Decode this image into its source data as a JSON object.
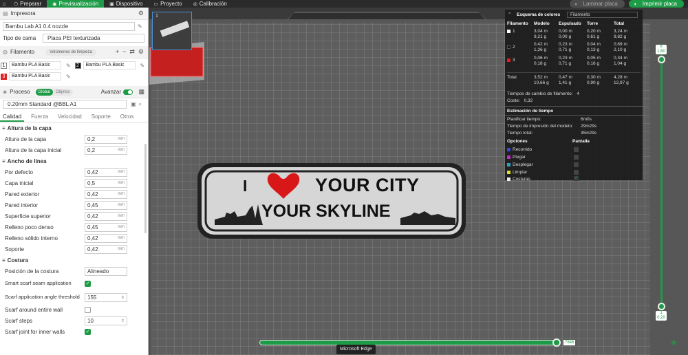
{
  "topbar": {
    "home_icon": "home-icon",
    "tabs": [
      {
        "label": "Preparar",
        "icon": "cube-icon"
      },
      {
        "label": "Previsualización",
        "icon": "eye-icon"
      },
      {
        "label": "Dispositivo",
        "icon": "printer-icon"
      },
      {
        "label": "Proyecto",
        "icon": "folder-icon"
      },
      {
        "label": "Calibración",
        "icon": "gauge-icon"
      }
    ],
    "laminar": "Laminar placa",
    "imprimir": "Imprimir placa"
  },
  "printer": {
    "section": "Impresora",
    "name": "Bambu Lab A1 0.4 nozzle",
    "bed_label": "Tipo de cama",
    "bed_value": "Placa PEI texturizada"
  },
  "filament": {
    "section": "Filamento",
    "pill": "Volúmenes de limpieza",
    "items": [
      {
        "num": "1",
        "name": "Bambu PLA Basic",
        "color": "#ffffff"
      },
      {
        "num": "2",
        "name": "Bambu PLA Basic",
        "color": "#111111"
      },
      {
        "num": "3",
        "name": "Bambu PLA Basic",
        "color": "#e02020"
      }
    ]
  },
  "process": {
    "section": "Proceso",
    "global": "Global",
    "objects": "Objetos",
    "advanced": "Avanzar",
    "profile": "0.20mm Standard @BBL A1",
    "tabs": [
      "Calidad",
      "Fuerza",
      "Velocidad",
      "Soporte",
      "Otros"
    ]
  },
  "params": {
    "layer_group": "Altura de la capa",
    "layer_height_label": "Altura de la capa",
    "layer_height": "0,2",
    "first_layer_label": "Altura de la capa inicial",
    "first_layer": "0,2",
    "width_group": "Ancho de línea",
    "w_default_label": "Por defecto",
    "w_default": "0,42",
    "w_initial_label": "Capa inicial",
    "w_initial": "0,5",
    "w_outer_label": "Pared exterior",
    "w_outer": "0,42",
    "w_inner_label": "Pared interior",
    "w_inner": "0,45",
    "w_top_label": "Superficie superior",
    "w_top": "0,42",
    "w_sparse_label": "Relleno poco denso",
    "w_sparse": "0,45",
    "w_solid_label": "Relleno sólido interno",
    "w_solid": "0,42",
    "w_support_label": "Soporte",
    "w_support": "0,42",
    "seam_group": "Costura",
    "seam_pos_label": "Posición de la costura",
    "seam_pos": "Alineado",
    "scarf_label": "Smart scarf seam application",
    "scarf_thresh_label": "Scarf application angle threshold",
    "scarf_thresh": "155",
    "scarf_around_label": "Scarf around entire wall",
    "scarf_steps_label": "Scarf steps",
    "scarf_steps": "10",
    "scarf_inner_label": "Scarf joint for inner walls",
    "unit": "mm"
  },
  "plate": {
    "number": "1",
    "line1": "YOUR CITY",
    "line2": "YOUR SKYLINE",
    "prefix": "I"
  },
  "stats": {
    "scheme_label": "Esquema de colores",
    "scheme_value": "Filamento",
    "headers": [
      "Filamento",
      "Modelo",
      "Expulsado",
      "Torre",
      "Total"
    ],
    "rows": [
      {
        "id": "1",
        "color": "#ffffff",
        "modelo": [
          "3,04 m",
          "9,21 g"
        ],
        "expulsado": [
          "0,00 m",
          "0,00 g"
        ],
        "torre": [
          "0,20 m",
          "0,61 g"
        ],
        "total": [
          "3,24 m",
          "9,82 g"
        ]
      },
      {
        "id": "2",
        "color": "#111111",
        "modelo": [
          "0,42 m",
          "1,26 g"
        ],
        "expulsado": [
          "0,23 m",
          "0,71 g"
        ],
        "torre": [
          "0,04 m",
          "0,13 g"
        ],
        "total": [
          "0,69 m",
          "2,10 g"
        ]
      },
      {
        "id": "3",
        "color": "#e02020",
        "modelo": [
          "0,06 m",
          "0,18 g"
        ],
        "expulsado": [
          "0,23 m",
          "0,71 g"
        ],
        "torre": [
          "0,05 m",
          "0,16 g"
        ],
        "total": [
          "0,34 m",
          "1,04 g"
        ]
      }
    ],
    "total_label": "Total",
    "total": {
      "modelo": [
        "3,52 m",
        "10,66 g"
      ],
      "expulsado": [
        "0,47 m",
        "1,41 g"
      ],
      "torre": [
        "0,30 m",
        "0,90 g"
      ],
      "total": [
        "4,28 m",
        "12,97 g"
      ]
    },
    "changes_label": "Tiempos de cambio de filamento:",
    "changes": "4",
    "cost_label": "Coste:",
    "cost": "0,32",
    "time_title": "Estimación de tiempo",
    "plan_label": "Planificar tiempo:",
    "plan": "6m0s",
    "model_time_label": "Tiempo de impresión del modelo:",
    "model_time": "29m29s",
    "total_time_label": "Tiempo total:",
    "total_time": "35m29s",
    "opt_header": "Opciones",
    "screen_header": "Pantalla",
    "options": [
      {
        "label": "Recorrido",
        "color": "#3a4bd8",
        "checked": false
      },
      {
        "label": "Plegar",
        "color": "#c030c0",
        "checked": false
      },
      {
        "label": "Desplegar",
        "color": "#30a0c0",
        "checked": false
      },
      {
        "label": "Limpiar",
        "color": "#e0e030",
        "checked": false
      },
      {
        "label": "Costuras",
        "color": "#eeeeee",
        "checked": true
      }
    ]
  },
  "sliders": {
    "top_layer": "8",
    "top_height": "1,60",
    "bottom_layer": "1",
    "bottom_height": "0,20",
    "moves": "7846"
  },
  "tooltip": "Microsoft Edge"
}
